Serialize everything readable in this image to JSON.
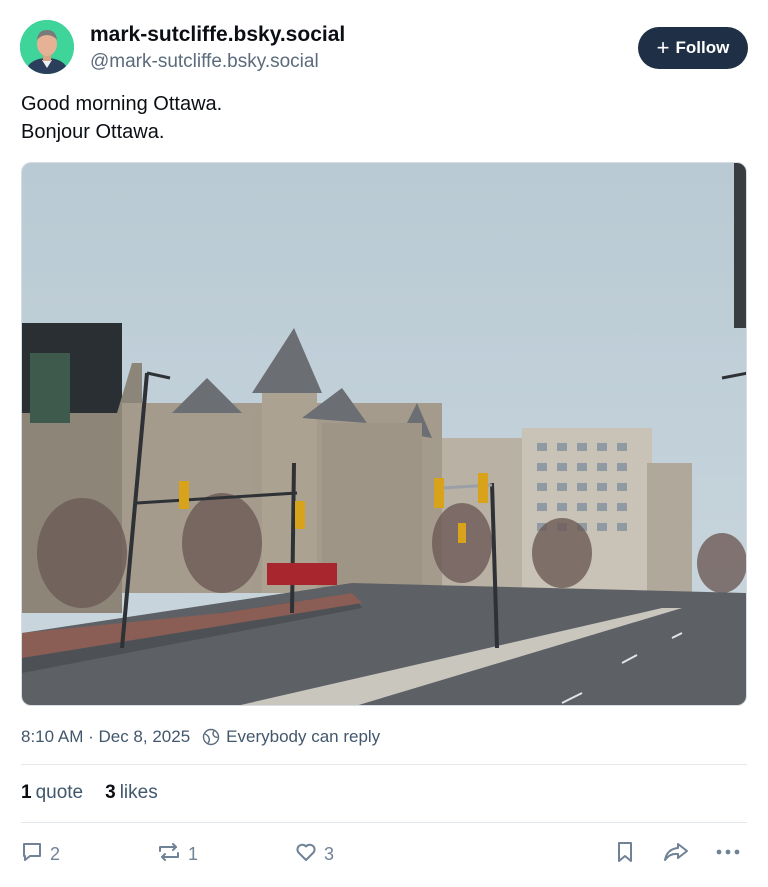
{
  "author": {
    "display_name": "mark-sutcliffe.bsky.social",
    "handle": "@mark-sutcliffe.bsky.social",
    "avatar_bg": "#3fd49a"
  },
  "follow_button": {
    "label": "Follow",
    "icon": "plus-icon",
    "bg": "#1f2f46"
  },
  "post": {
    "lines": [
      "Good morning Ottawa.",
      "Bonjour Ottawa."
    ],
    "image_icon": "photo-of-chateau-laurier-foggy-street"
  },
  "meta": {
    "timestamp": "8:10 AM · Dec 8, 2025",
    "reply_setting": "Everybody can reply",
    "reply_icon": "globe-icon"
  },
  "counts": {
    "quotes": {
      "value": "1",
      "label": "quote"
    },
    "likes": {
      "value": "3",
      "label": "likes"
    }
  },
  "actions": {
    "reply_count": "2",
    "repost_count": "1",
    "like_count": "3",
    "icons": [
      "reply-icon",
      "repost-icon",
      "like-icon",
      "bookmark-icon",
      "share-icon",
      "more-icon"
    ]
  }
}
